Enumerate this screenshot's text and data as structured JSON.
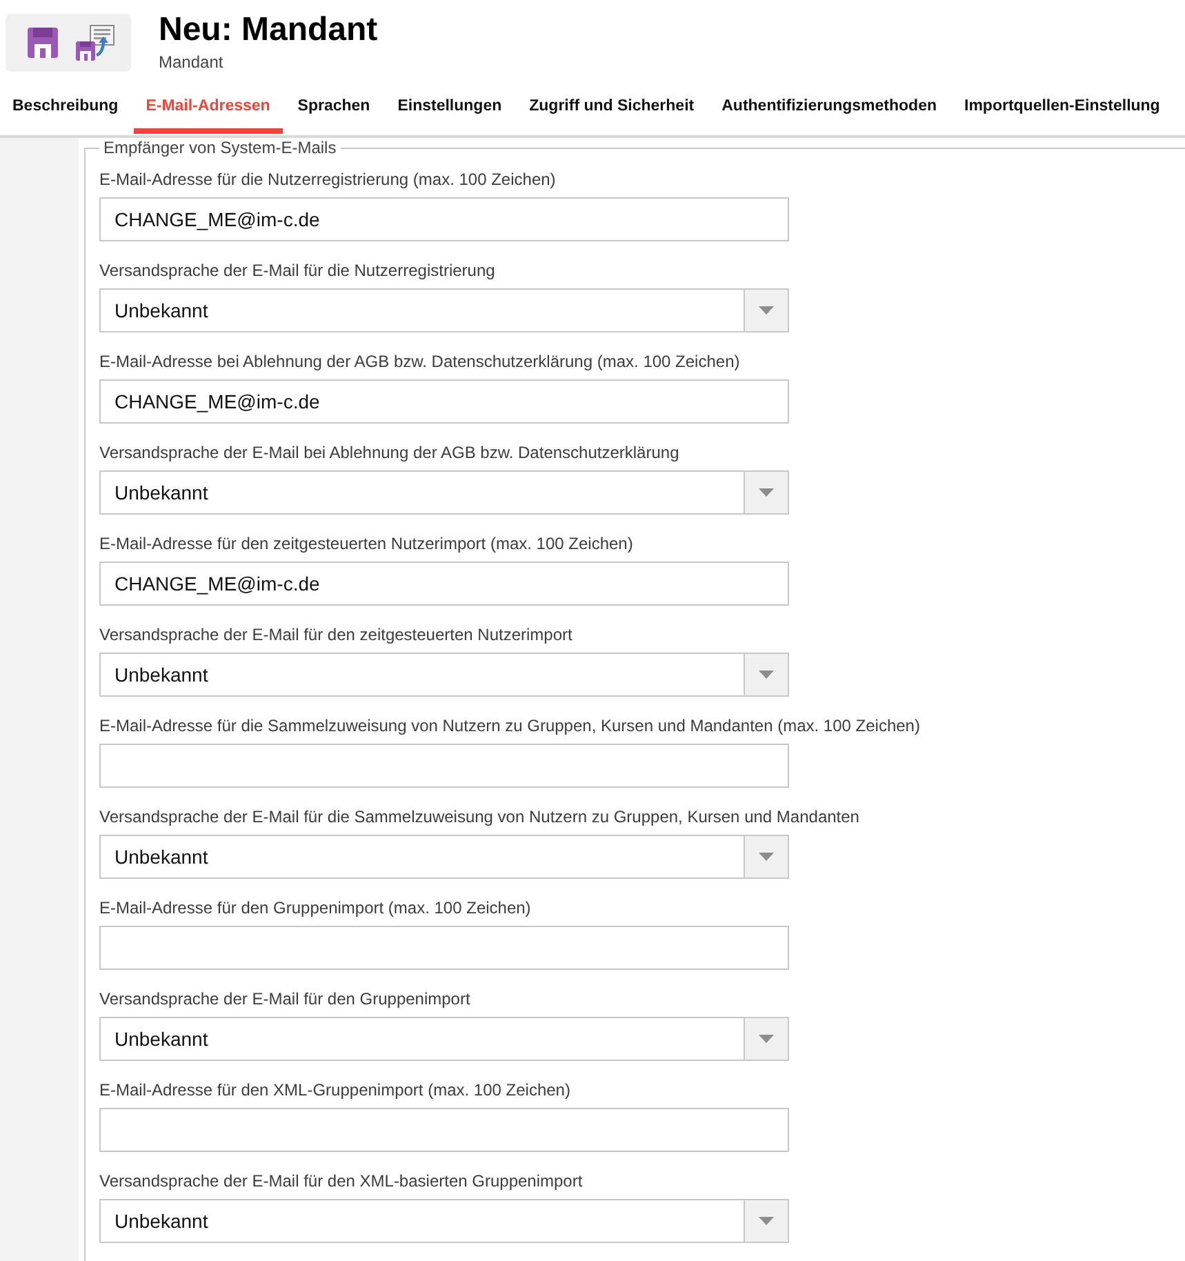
{
  "header": {
    "title": "Neu: Mandant",
    "subtitle": "Mandant"
  },
  "tabs": [
    {
      "label": "Beschreibung",
      "selected": false
    },
    {
      "label": "E-Mail-Adressen",
      "selected": true
    },
    {
      "label": "Sprachen",
      "selected": false
    },
    {
      "label": "Einstellungen",
      "selected": false
    },
    {
      "label": "Zugriff und Sicherheit",
      "selected": false
    },
    {
      "label": "Authentifizierungsmethoden",
      "selected": false
    },
    {
      "label": "Importquellen-Einstellung",
      "selected": false
    }
  ],
  "section": {
    "legend": "Empfänger von System-E-Mails",
    "fields": [
      {
        "kind": "text",
        "label": "E-Mail-Adresse für die Nutzerregistrierung (max. 100 Zeichen)",
        "value": "CHANGE_ME@im-c.de"
      },
      {
        "kind": "select",
        "label": "Versandsprache der E-Mail für die Nutzerregistrierung",
        "value": "Unbekannt"
      },
      {
        "kind": "text",
        "label": "E-Mail-Adresse bei Ablehnung der AGB bzw. Datenschutzerklärung (max. 100 Zeichen)",
        "value": "CHANGE_ME@im-c.de"
      },
      {
        "kind": "select",
        "label": "Versandsprache der E-Mail bei Ablehnung der AGB bzw. Datenschutzerklärung",
        "value": "Unbekannt"
      },
      {
        "kind": "text",
        "label": "E-Mail-Adresse für den zeitgesteuerten Nutzerimport (max. 100 Zeichen)",
        "value": "CHANGE_ME@im-c.de"
      },
      {
        "kind": "select",
        "label": "Versandsprache der E-Mail für den zeitgesteuerten Nutzerimport",
        "value": "Unbekannt"
      },
      {
        "kind": "text",
        "label": "E-Mail-Adresse für die Sammelzuweisung von Nutzern zu Gruppen, Kursen und Mandanten (max. 100 Zeichen)"
      },
      {
        "kind": "select",
        "label": "Versandsprache der E-Mail für die Sammelzuweisung von Nutzern zu Gruppen, Kursen und Mandanten",
        "value": "Unbekannt"
      },
      {
        "kind": "text",
        "label": "E-Mail-Adresse für den Gruppenimport (max. 100 Zeichen)"
      },
      {
        "kind": "select",
        "label": "Versandsprache der E-Mail für den Gruppenimport",
        "value": "Unbekannt"
      },
      {
        "kind": "text",
        "label": "E-Mail-Adresse für den XML-Gruppenimport (max. 100 Zeichen)"
      },
      {
        "kind": "select",
        "label": "Versandsprache der E-Mail für den XML-basierten Gruppenimport",
        "value": "Unbekannt"
      }
    ]
  }
}
